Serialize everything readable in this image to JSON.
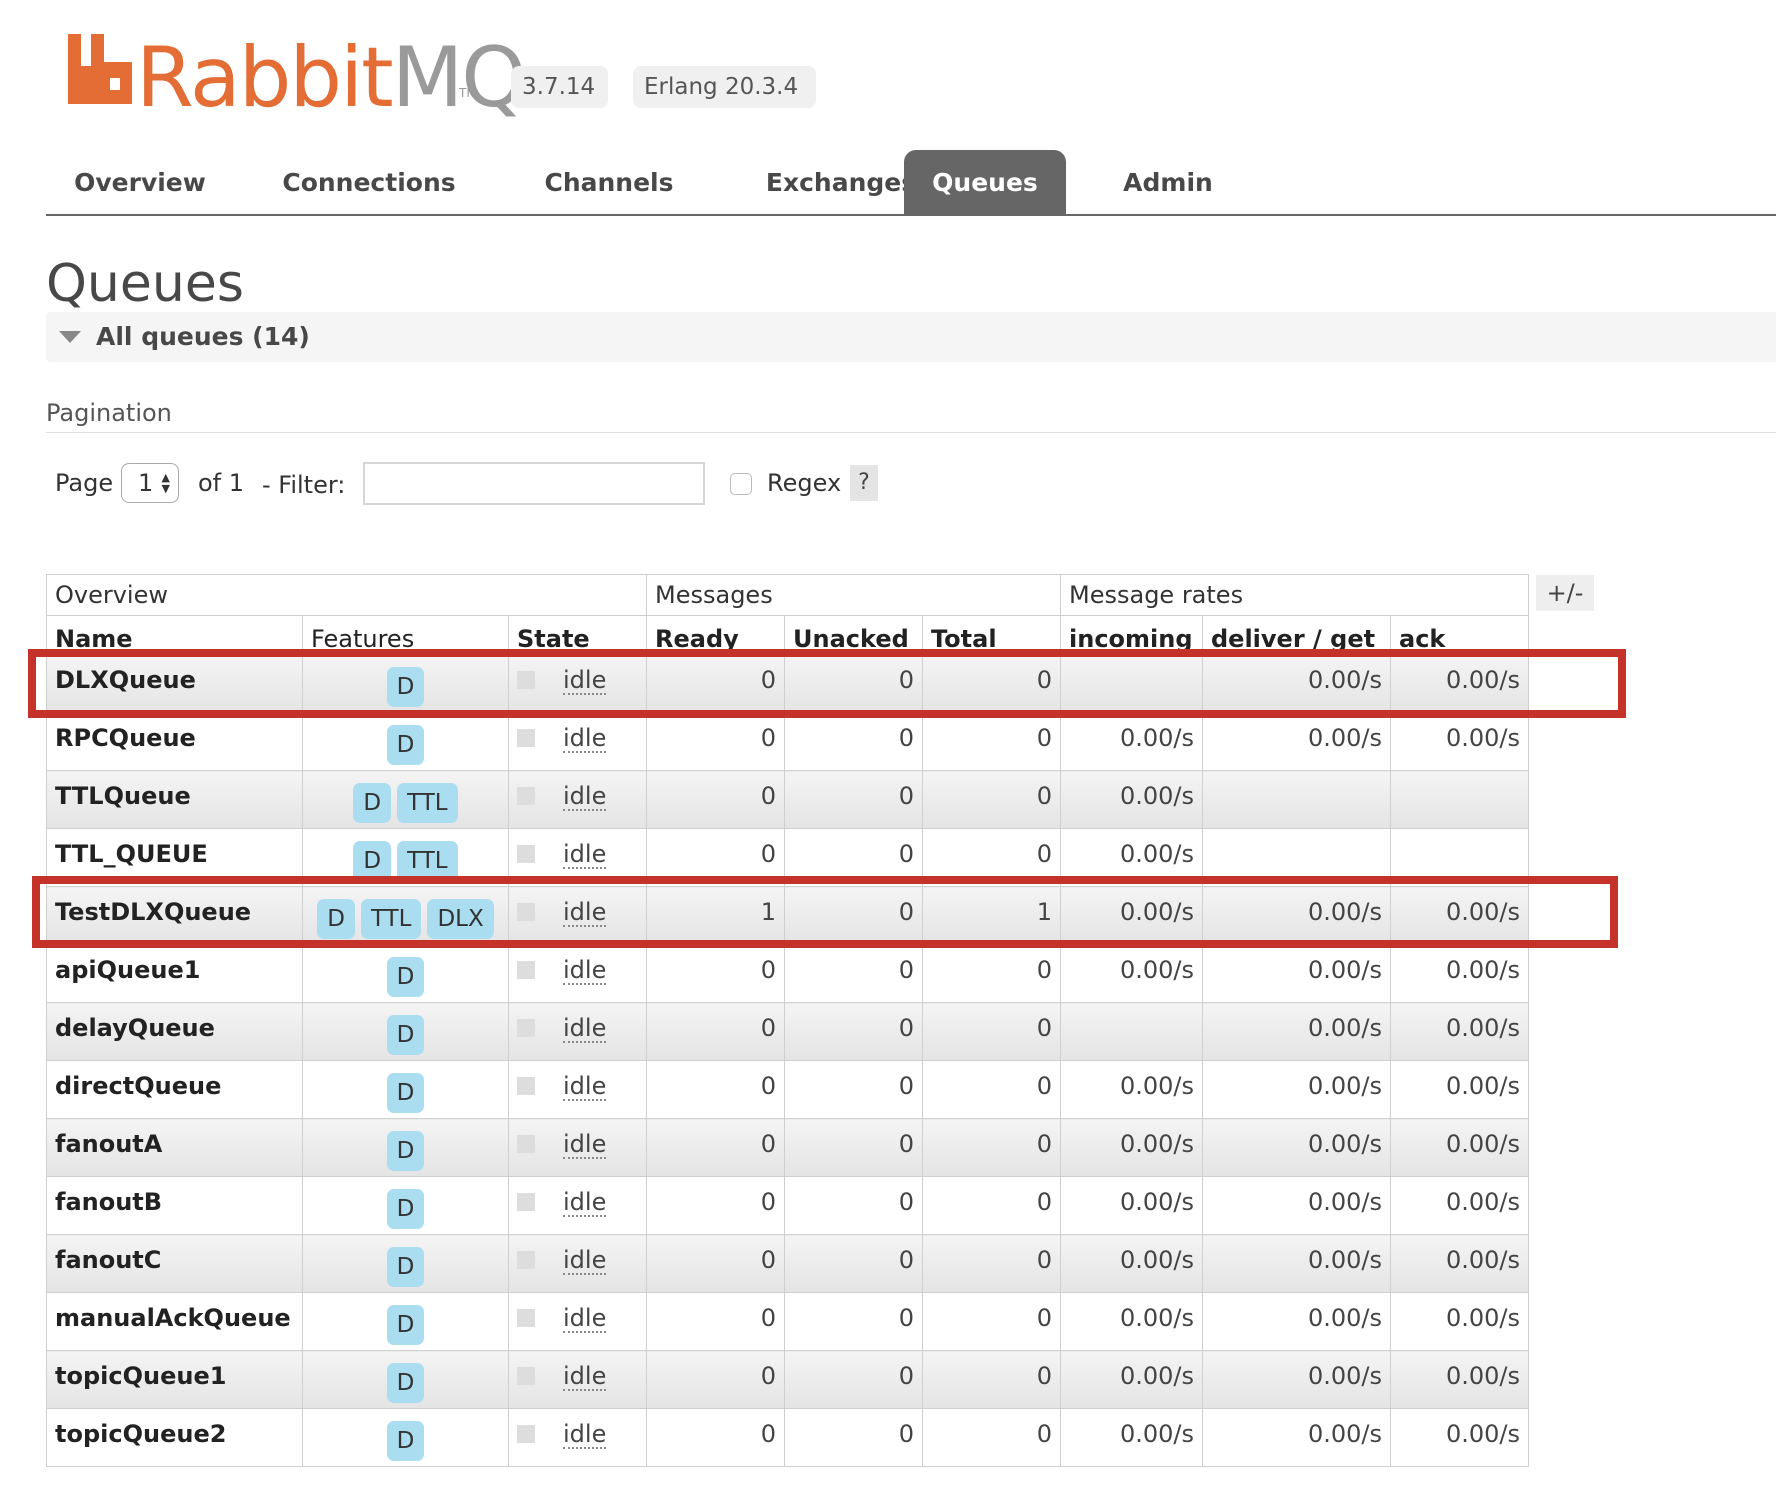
{
  "app": {
    "logo_rabbit": "Rabbit",
    "logo_mq": "MQ",
    "logo_tm": "TM",
    "accent": "#e46d35"
  },
  "versions": [
    "3.7.14",
    "Erlang 20.3.4"
  ],
  "tabs": [
    {
      "label": "Overview"
    },
    {
      "label": "Connections"
    },
    {
      "label": "Channels"
    },
    {
      "label": "Exchanges"
    },
    {
      "label": "Queues",
      "active": true
    },
    {
      "label": "Admin"
    }
  ],
  "page": {
    "title": "Queues",
    "section": "All queues (14)"
  },
  "pagination": {
    "heading": "Pagination",
    "page_label": "Page",
    "page_value": "1",
    "of_label": "of 1",
    "filter_label": "- Filter:",
    "filter_value": "",
    "regex_label": "Regex",
    "help_label": "?"
  },
  "table": {
    "toggle_label": "+/-",
    "groups": [
      "Overview",
      "Messages",
      "Message rates"
    ],
    "columns": [
      "Name",
      "Features",
      "State",
      "Ready",
      "Unacked",
      "Total",
      "incoming",
      "deliver / get",
      "ack"
    ],
    "rows": [
      {
        "name": "DLXQueue",
        "features": [
          "D"
        ],
        "state": "idle",
        "ready": "0",
        "unacked": "0",
        "total": "0",
        "incoming": "",
        "deliver": "0.00/s",
        "ack": "0.00/s"
      },
      {
        "name": "RPCQueue",
        "features": [
          "D"
        ],
        "state": "idle",
        "ready": "0",
        "unacked": "0",
        "total": "0",
        "incoming": "0.00/s",
        "deliver": "0.00/s",
        "ack": "0.00/s"
      },
      {
        "name": "TTLQueue",
        "features": [
          "D",
          "TTL"
        ],
        "state": "idle",
        "ready": "0",
        "unacked": "0",
        "total": "0",
        "incoming": "0.00/s",
        "deliver": "",
        "ack": ""
      },
      {
        "name": "TTL_QUEUE",
        "features": [
          "D",
          "TTL"
        ],
        "state": "idle",
        "ready": "0",
        "unacked": "0",
        "total": "0",
        "incoming": "0.00/s",
        "deliver": "",
        "ack": ""
      },
      {
        "name": "TestDLXQueue",
        "features": [
          "D",
          "TTL",
          "DLX"
        ],
        "state": "idle",
        "ready": "1",
        "unacked": "0",
        "total": "1",
        "incoming": "0.00/s",
        "deliver": "0.00/s",
        "ack": "0.00/s"
      },
      {
        "name": "apiQueue1",
        "features": [
          "D"
        ],
        "state": "idle",
        "ready": "0",
        "unacked": "0",
        "total": "0",
        "incoming": "0.00/s",
        "deliver": "0.00/s",
        "ack": "0.00/s"
      },
      {
        "name": "delayQueue",
        "features": [
          "D"
        ],
        "state": "idle",
        "ready": "0",
        "unacked": "0",
        "total": "0",
        "incoming": "",
        "deliver": "0.00/s",
        "ack": "0.00/s"
      },
      {
        "name": "directQueue",
        "features": [
          "D"
        ],
        "state": "idle",
        "ready": "0",
        "unacked": "0",
        "total": "0",
        "incoming": "0.00/s",
        "deliver": "0.00/s",
        "ack": "0.00/s"
      },
      {
        "name": "fanoutA",
        "features": [
          "D"
        ],
        "state": "idle",
        "ready": "0",
        "unacked": "0",
        "total": "0",
        "incoming": "0.00/s",
        "deliver": "0.00/s",
        "ack": "0.00/s"
      },
      {
        "name": "fanoutB",
        "features": [
          "D"
        ],
        "state": "idle",
        "ready": "0",
        "unacked": "0",
        "total": "0",
        "incoming": "0.00/s",
        "deliver": "0.00/s",
        "ack": "0.00/s"
      },
      {
        "name": "fanoutC",
        "features": [
          "D"
        ],
        "state": "idle",
        "ready": "0",
        "unacked": "0",
        "total": "0",
        "incoming": "0.00/s",
        "deliver": "0.00/s",
        "ack": "0.00/s"
      },
      {
        "name": "manualAckQueue",
        "features": [
          "D"
        ],
        "state": "idle",
        "ready": "0",
        "unacked": "0",
        "total": "0",
        "incoming": "0.00/s",
        "deliver": "0.00/s",
        "ack": "0.00/s"
      },
      {
        "name": "topicQueue1",
        "features": [
          "D"
        ],
        "state": "idle",
        "ready": "0",
        "unacked": "0",
        "total": "0",
        "incoming": "0.00/s",
        "deliver": "0.00/s",
        "ack": "0.00/s"
      },
      {
        "name": "topicQueue2",
        "features": [
          "D"
        ],
        "state": "idle",
        "ready": "0",
        "unacked": "0",
        "total": "0",
        "incoming": "0.00/s",
        "deliver": "0.00/s",
        "ack": "0.00/s"
      }
    ]
  },
  "annotations": {
    "highlight_color": "#c4322a",
    "highlighted_rows": [
      "DLXQueue",
      "TestDLXQueue"
    ]
  }
}
